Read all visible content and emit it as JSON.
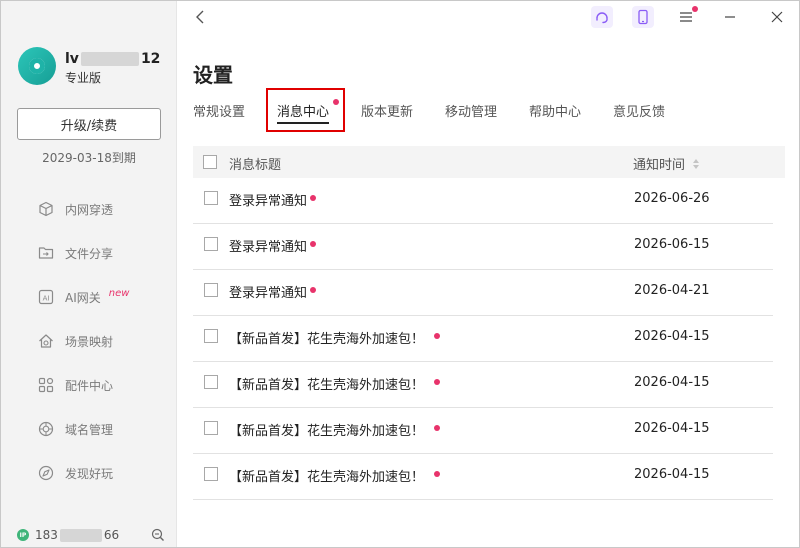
{
  "user": {
    "name_prefix": "lv",
    "name_suffix": "12",
    "plan": "专业版",
    "upgrade_label": "升级/续费",
    "expiry": "2029-03-18到期"
  },
  "sidebar": {
    "items": [
      {
        "label": "内网穿透",
        "icon": "cube-icon"
      },
      {
        "label": "文件分享",
        "icon": "folder-share-icon"
      },
      {
        "label": "AI网关",
        "icon": "ai-icon",
        "badge": "new"
      },
      {
        "label": "场景映射",
        "icon": "home-icon"
      },
      {
        "label": "配件中心",
        "icon": "grid-icon"
      },
      {
        "label": "域名管理",
        "icon": "globe-icon"
      },
      {
        "label": "发现好玩",
        "icon": "compass-icon"
      }
    ],
    "footer": {
      "phone_prefix": "183",
      "phone_suffix": "66",
      "ip_label": "IP"
    }
  },
  "header": {
    "title": "设置"
  },
  "tabs": [
    {
      "label": "常规设置",
      "active": false
    },
    {
      "label": "消息中心",
      "active": true,
      "unread_dot": true
    },
    {
      "label": "版本更新",
      "active": false
    },
    {
      "label": "移动管理",
      "active": false
    },
    {
      "label": "帮助中心",
      "active": false
    },
    {
      "label": "意见反馈",
      "active": false
    }
  ],
  "table": {
    "columns": {
      "title": "消息标题",
      "time": "通知时间"
    },
    "rows": [
      {
        "title": "登录异常通知",
        "date": "2026-06-26",
        "unread": true
      },
      {
        "title": "登录异常通知",
        "date": "2026-06-15",
        "unread": true
      },
      {
        "title": "登录异常通知",
        "date": "2026-04-21",
        "unread": true
      },
      {
        "title": "【新品首发】花生壳海外加速包！",
        "date": "2026-04-15",
        "unread": true
      },
      {
        "title": "【新品首发】花生壳海外加速包！",
        "date": "2026-04-15",
        "unread": true
      },
      {
        "title": "【新品首发】花生壳海外加速包！",
        "date": "2026-04-15",
        "unread": true
      },
      {
        "title": "【新品首发】花生壳海外加速包！",
        "date": "2026-04-15",
        "unread": true
      }
    ]
  },
  "colors": {
    "accent_dot": "#e8336b",
    "highlight_box": "#e00000",
    "sidebar_bg": "#f3f3f3",
    "icon_purple": "#8a5cf6"
  }
}
